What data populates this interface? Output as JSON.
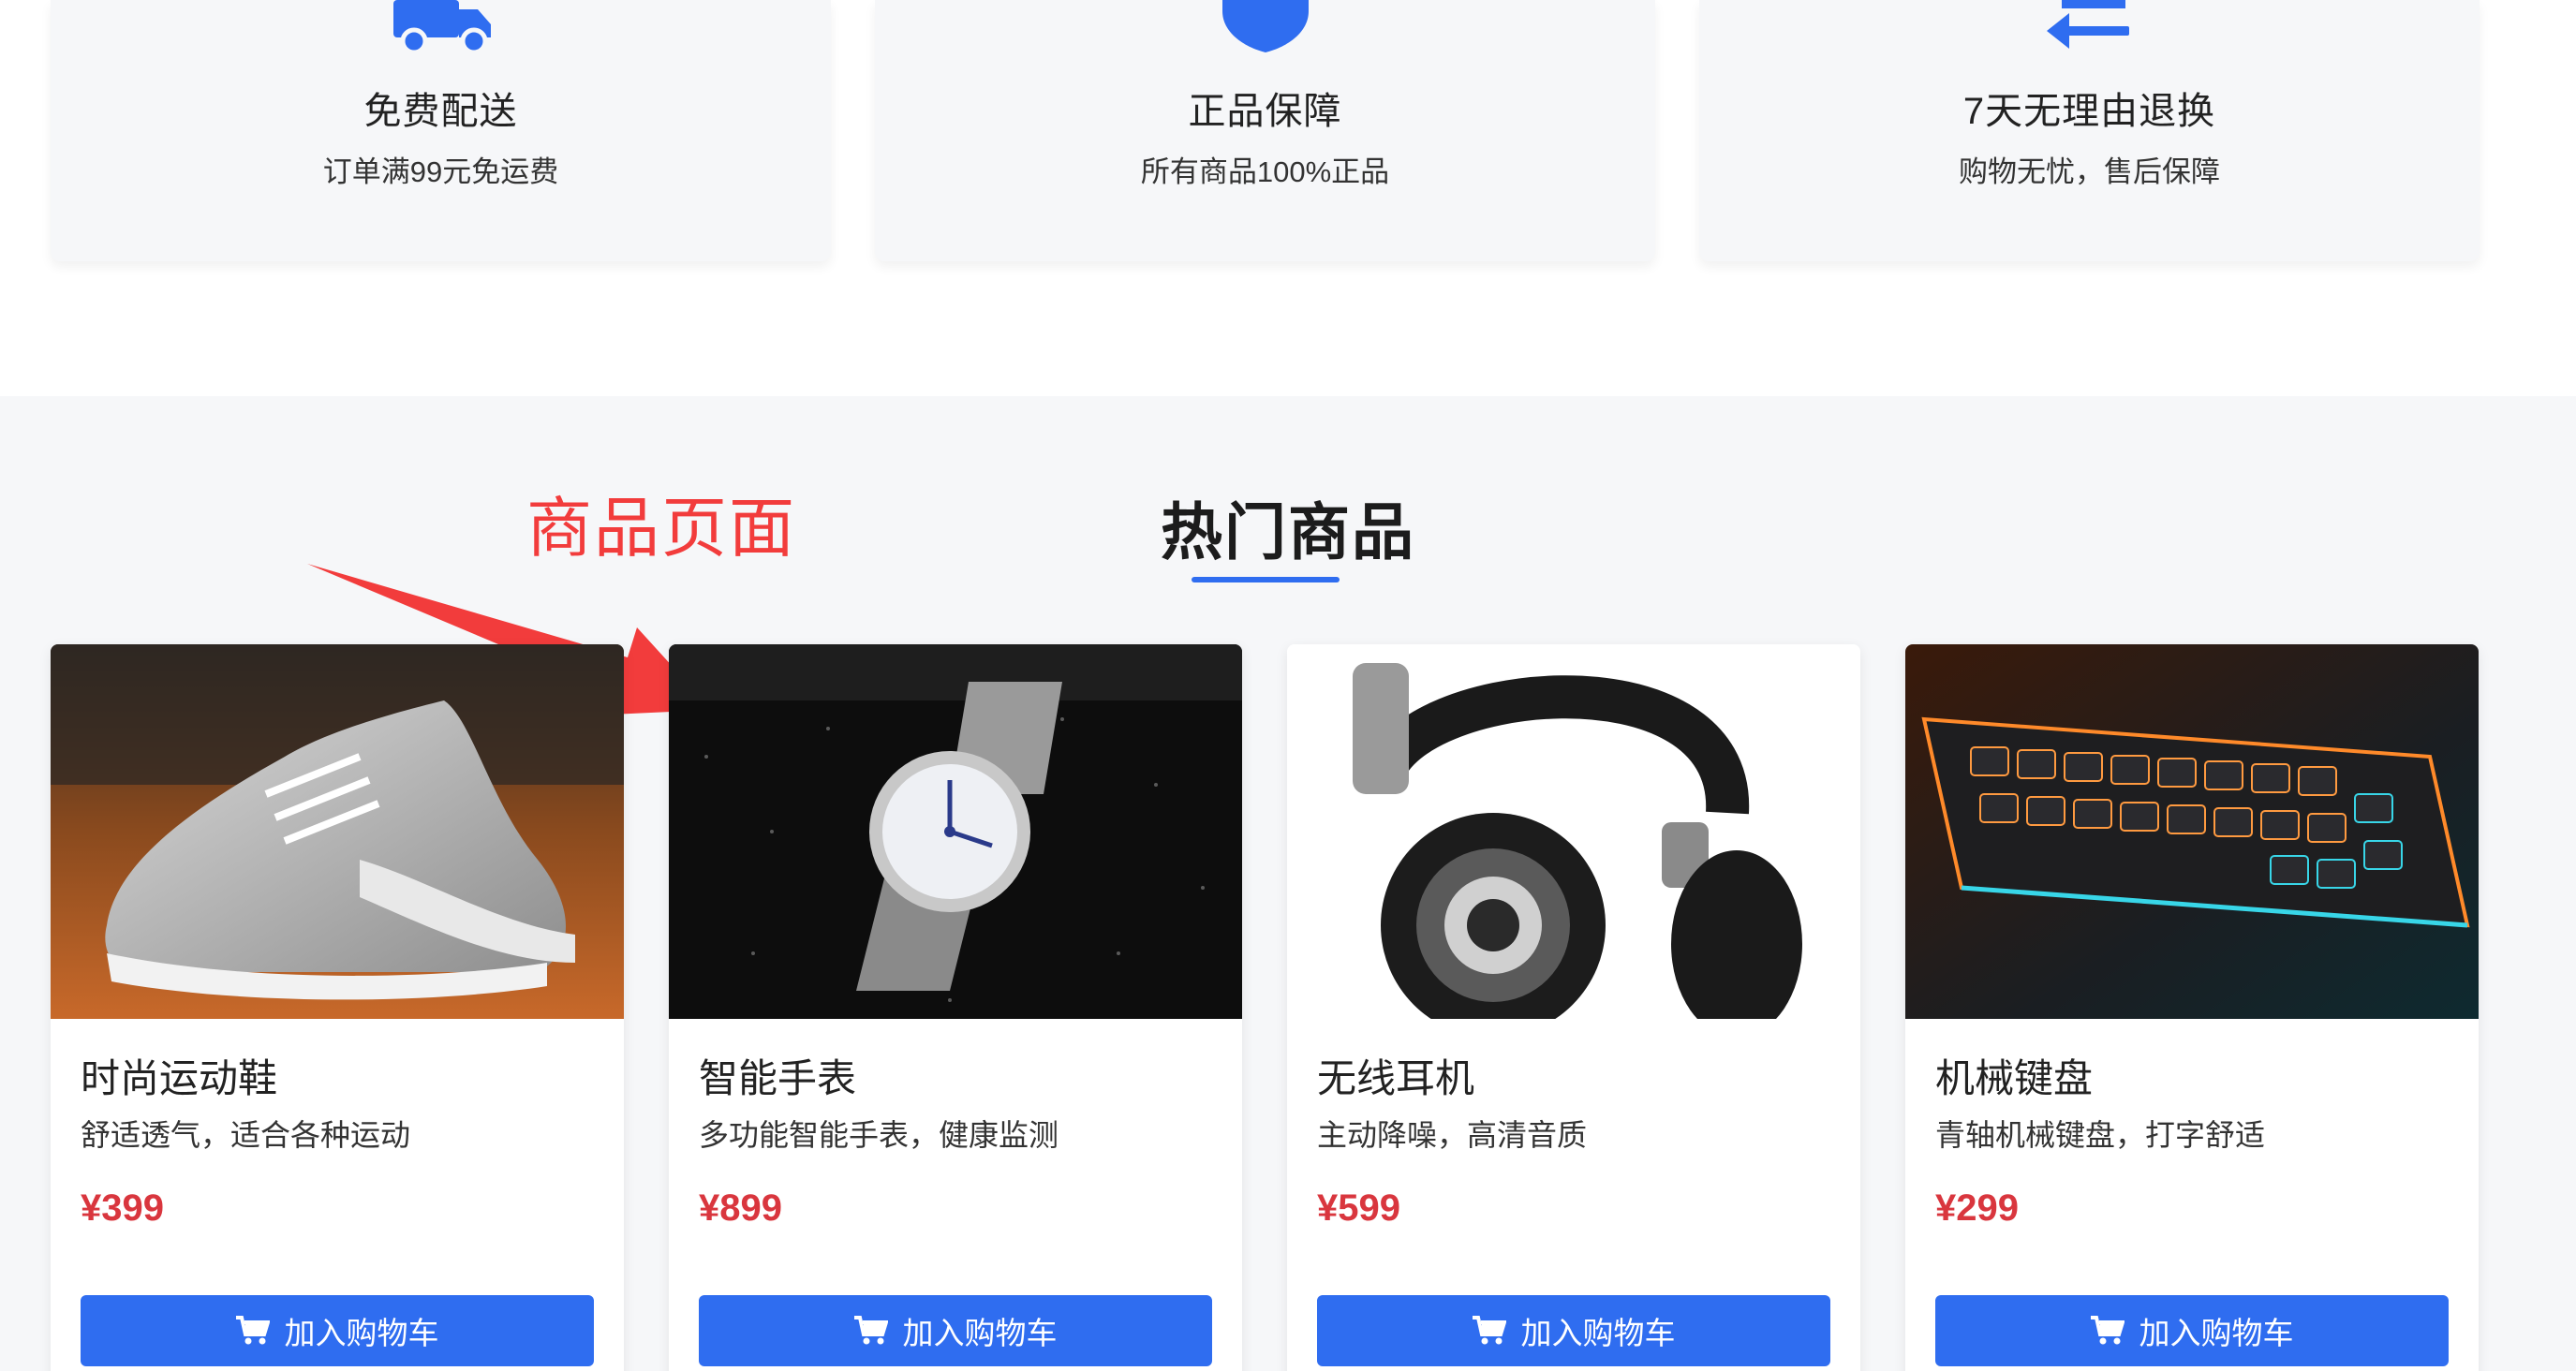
{
  "features": [
    {
      "icon": "truck-icon",
      "title": "免费配送",
      "desc": "订单满99元免运费"
    },
    {
      "icon": "shield-icon",
      "title": "正品保障",
      "desc": "所有商品100%正品"
    },
    {
      "icon": "exchange-arrows-icon",
      "title": "7天无理由退换",
      "desc": "购物无忧，售后保障"
    }
  ],
  "annotation": {
    "text": "商品页面",
    "color": "#f23c3c"
  },
  "section": {
    "title": "热门商品",
    "accent": "#2f6df0"
  },
  "products": [
    {
      "name": "时尚运动鞋",
      "desc": "舒适透气，适合各种运动",
      "price": "¥399",
      "button": "加入购物车",
      "image": "sneaker-photo"
    },
    {
      "name": "智能手表",
      "desc": "多功能智能手表，健康监测",
      "price": "¥899",
      "button": "加入购物车",
      "image": "watch-photo"
    },
    {
      "name": "无线耳机",
      "desc": "主动降噪，高清音质",
      "price": "¥599",
      "button": "加入购物车",
      "image": "headphones-photo"
    },
    {
      "name": "机械键盘",
      "desc": "青轴机械键盘，打字舒适",
      "price": "¥299",
      "button": "加入购物车",
      "image": "keyboard-photo"
    }
  ],
  "colors": {
    "primary": "#2f6df0",
    "price": "#d9363e",
    "section_bg": "#f6f7f9"
  }
}
